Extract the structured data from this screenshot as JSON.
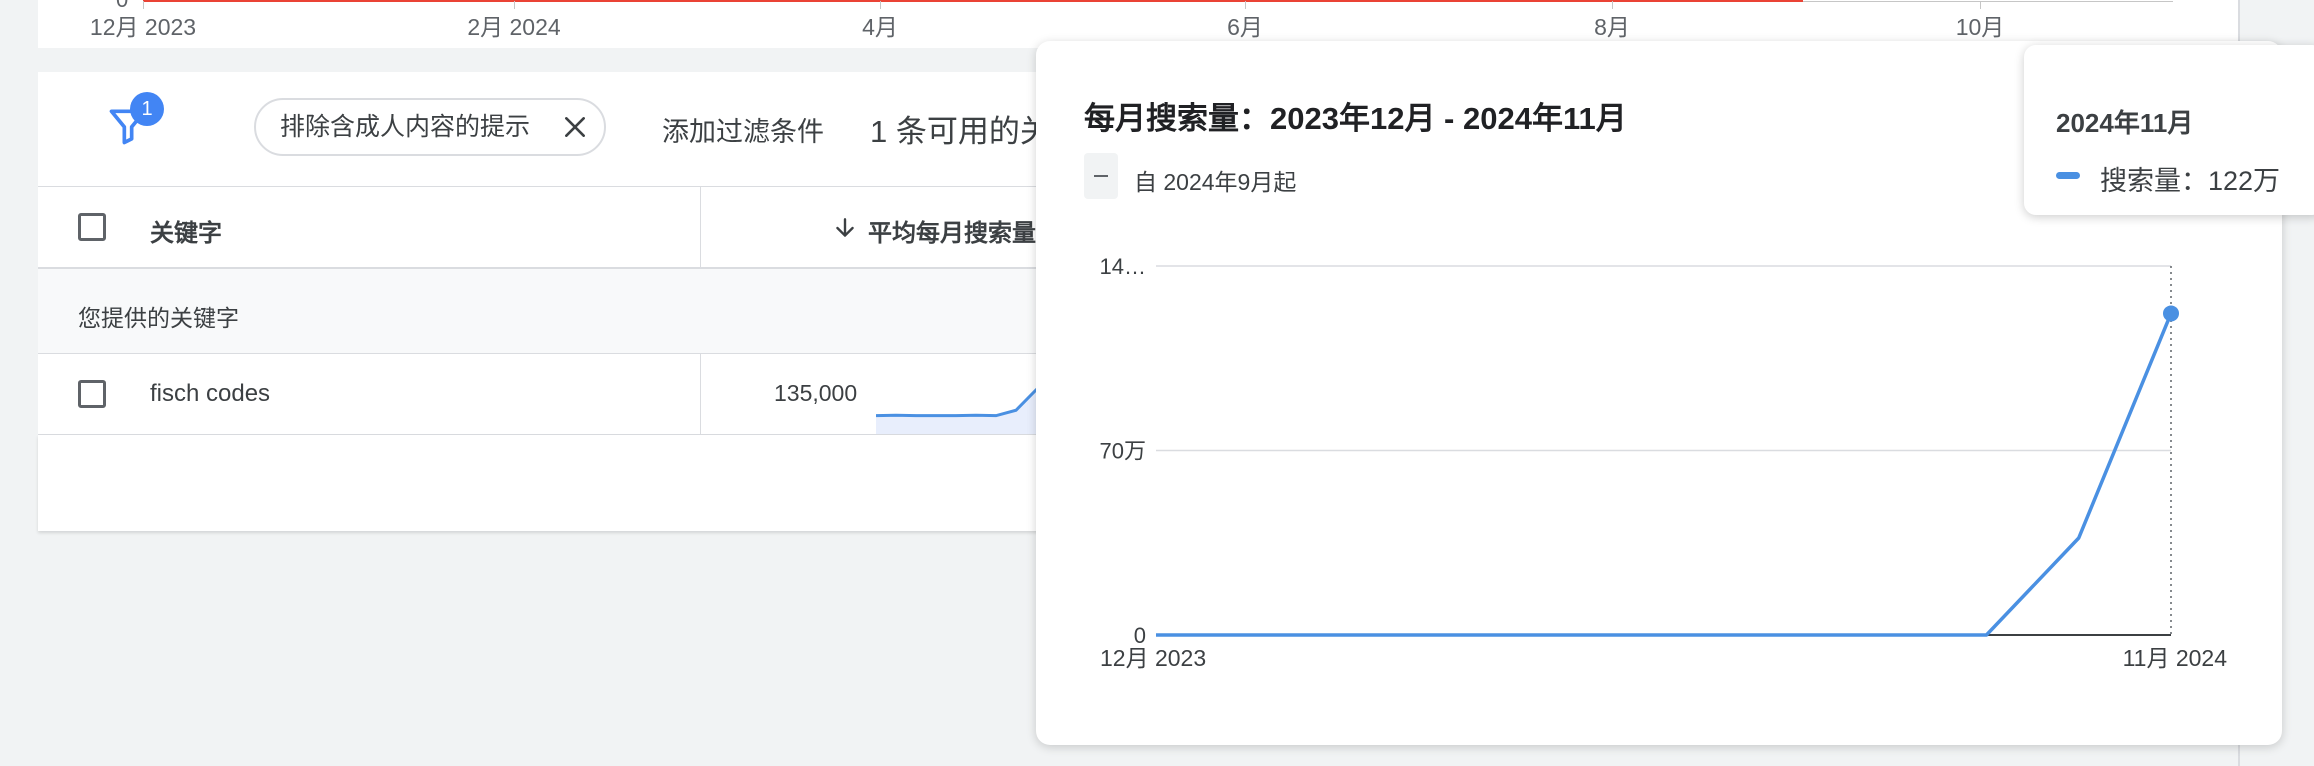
{
  "top_chart": {
    "zero_label": "0",
    "ticks": [
      "12月 2023",
      "2月 2024",
      "4月",
      "6月",
      "8月",
      "10月"
    ]
  },
  "filter_bar": {
    "badge_count": "1",
    "chip_label": "排除含成人内容的提示",
    "add_filter_label": "添加过滤条件",
    "available_text": "1 条可用的关"
  },
  "table": {
    "header_keyword": "关键字",
    "header_volume": "平均每月搜索量",
    "section_label": "您提供的关键字",
    "rows": [
      {
        "keyword": "fisch codes",
        "avg_volume": "135,000"
      }
    ]
  },
  "popup": {
    "title": "每月搜索量：2023年12月 - 2024年11月",
    "legend_label": "自 2024年9月起"
  },
  "tooltip": {
    "title": "2024年11月",
    "series_label": "搜索量：122万"
  },
  "chart_data": {
    "type": "line",
    "title": "每月搜索量：2023年12月 - 2024年11月",
    "x": [
      "2023-12",
      "2024-01",
      "2024-02",
      "2024-03",
      "2024-04",
      "2024-05",
      "2024-06",
      "2024-07",
      "2024-08",
      "2024-09",
      "2024-10",
      "2024-11"
    ],
    "x_tick_labels": [
      "12月 2023",
      "11月 2024"
    ],
    "y_tick_labels": [
      "0",
      "70万",
      "14…"
    ],
    "y_ticks": [
      0,
      700000,
      1400000
    ],
    "ylim": [
      0,
      1400000
    ],
    "series": [
      {
        "name": "搜索量",
        "values": [
          0,
          0,
          0,
          0,
          0,
          0,
          0,
          0,
          0,
          0,
          368000,
          1220000
        ],
        "color": "#4a90e2"
      }
    ],
    "highlighted_point": 11,
    "grid": true
  },
  "sparkline_values": [
    3,
    4,
    3,
    3,
    3,
    4,
    3,
    15,
    60,
    100
  ],
  "colors": {
    "accent_blue": "#4285f4",
    "line_blue": "#4a90e2",
    "red_line": "#ea4335"
  }
}
